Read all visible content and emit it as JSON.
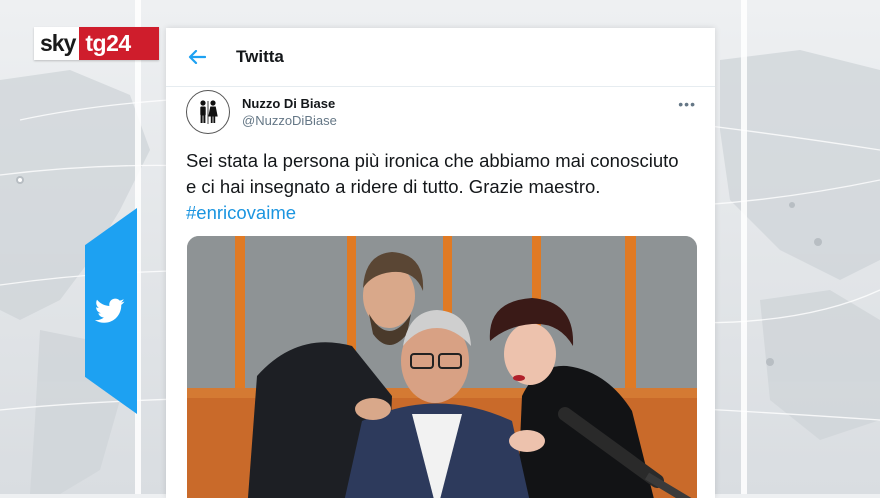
{
  "broadcaster": {
    "logo_left": "sky",
    "logo_right": "tg24"
  },
  "tweet_header": {
    "title": "Twitta"
  },
  "author": {
    "display_name": "Nuzzo Di Biase",
    "handle": "@NuzzoDiBiase"
  },
  "tweet": {
    "text": "Sei stata la persona più ironica che abbiamo mai conosciuto e ci hai insegnato a ridere di tutto. Grazie maestro.",
    "hashtag": "#enricovaime"
  },
  "icons": {
    "back": "back-arrow-icon",
    "more": "more-options-icon",
    "twitter": "twitter-bird-icon",
    "avatar": "restroom-sign-avatar"
  },
  "colors": {
    "twitter_blue": "#1da1f2",
    "hashtag": "#1b95e0",
    "logo_red": "#cf1d2c"
  }
}
